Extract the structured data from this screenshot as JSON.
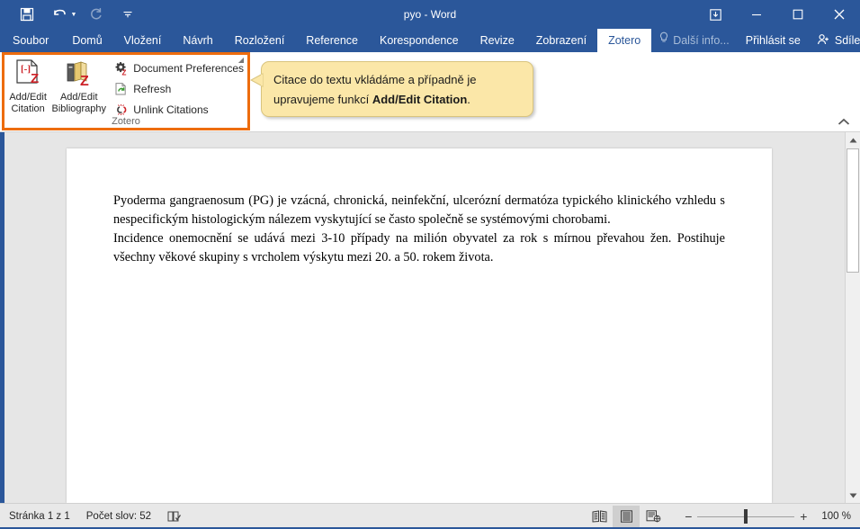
{
  "window": {
    "title": "pyo - Word",
    "quick_access": [
      {
        "name": "save-icon",
        "label": "Save"
      },
      {
        "name": "undo-icon",
        "label": "Undo"
      },
      {
        "name": "redo-icon",
        "label": "Redo"
      },
      {
        "name": "customize-qat-icon",
        "label": "Customize Quick Access Toolbar"
      }
    ],
    "controls": [
      {
        "name": "ribbon-display-options-icon",
        "label": "Ribbon Display Options"
      },
      {
        "name": "minimize-icon",
        "label": "Minimize"
      },
      {
        "name": "restore-icon",
        "label": "Restore Down"
      },
      {
        "name": "close-icon",
        "label": "Close"
      }
    ]
  },
  "tabs": [
    {
      "label": "Soubor",
      "active": false,
      "file": true
    },
    {
      "label": "Domů",
      "active": false
    },
    {
      "label": "Vložení",
      "active": false
    },
    {
      "label": "Návrh",
      "active": false
    },
    {
      "label": "Rozložení",
      "active": false
    },
    {
      "label": "Reference",
      "active": false
    },
    {
      "label": "Korespondence",
      "active": false
    },
    {
      "label": "Revize",
      "active": false
    },
    {
      "label": "Zobrazení",
      "active": false
    },
    {
      "label": "Zotero",
      "active": true
    }
  ],
  "tabstrip_right": {
    "tell_me": "Další info...",
    "tell_me_icon": "lightbulb-icon",
    "sign_in": "Přihlásit se",
    "share": "Sdílet",
    "share_icon": "person-share-icon"
  },
  "ribbon": {
    "group_title": "Zotero",
    "highlight_color": "#ed6c0e",
    "big_buttons": [
      {
        "name": "add-edit-citation",
        "line1": "Add/Edit",
        "line2": "Citation",
        "icon": "document-citation-z-icon"
      },
      {
        "name": "add-edit-bibliography",
        "line1": "Add/Edit",
        "line2": "Bibliography",
        "icon": "books-z-icon"
      }
    ],
    "small_buttons": [
      {
        "name": "document-preferences",
        "label": "Document Preferences",
        "icon": "gear-z-icon"
      },
      {
        "name": "refresh",
        "label": "Refresh",
        "icon": "refresh-icon"
      },
      {
        "name": "unlink-citations",
        "label": "Unlink Citations",
        "icon": "unlink-icon"
      }
    ],
    "collapse_icon": "chevron-up-icon"
  },
  "callout": {
    "text_before": "Citace do textu vkládáme a případně je upravujeme funkcí ",
    "text_bold": "Add/Edit Citation",
    "text_after": ".",
    "background": "#fbe7a8",
    "border": "#d9c47e"
  },
  "document": {
    "paragraph1": "Pyoderma gangraenosum (PG) je vzácná, chronická, neinfekční, ulcerózní dermatóza typického klinického vzhledu s nespecifickým histologickým nálezem vyskytující se často společně se systémovými chorobami.",
    "paragraph2": "Incidence onemocnění se udává mezi 3-10 případy na milión obyvatel za rok s mírnou převahou žen. Postihuje všechny věkové skupiny s vrcholem výskytu mezi 20. a 50. rokem života."
  },
  "scrollbar": {
    "up_icon": "scroll-up-icon",
    "down_icon": "scroll-down-icon",
    "thumb": "scroll-thumb"
  },
  "statusbar": {
    "page": "Stránka 1 z 1",
    "words": "Počet slov: 52",
    "proofing_icon": "proofing-icon",
    "views": [
      {
        "name": "read-mode-view",
        "icon": "read-mode-icon",
        "active": false
      },
      {
        "name": "print-layout-view",
        "icon": "print-layout-icon",
        "active": true
      },
      {
        "name": "web-layout-view",
        "icon": "web-layout-icon",
        "active": false
      }
    ],
    "zoom_out": "−",
    "zoom_in": "+",
    "zoom_value": "100 %"
  }
}
